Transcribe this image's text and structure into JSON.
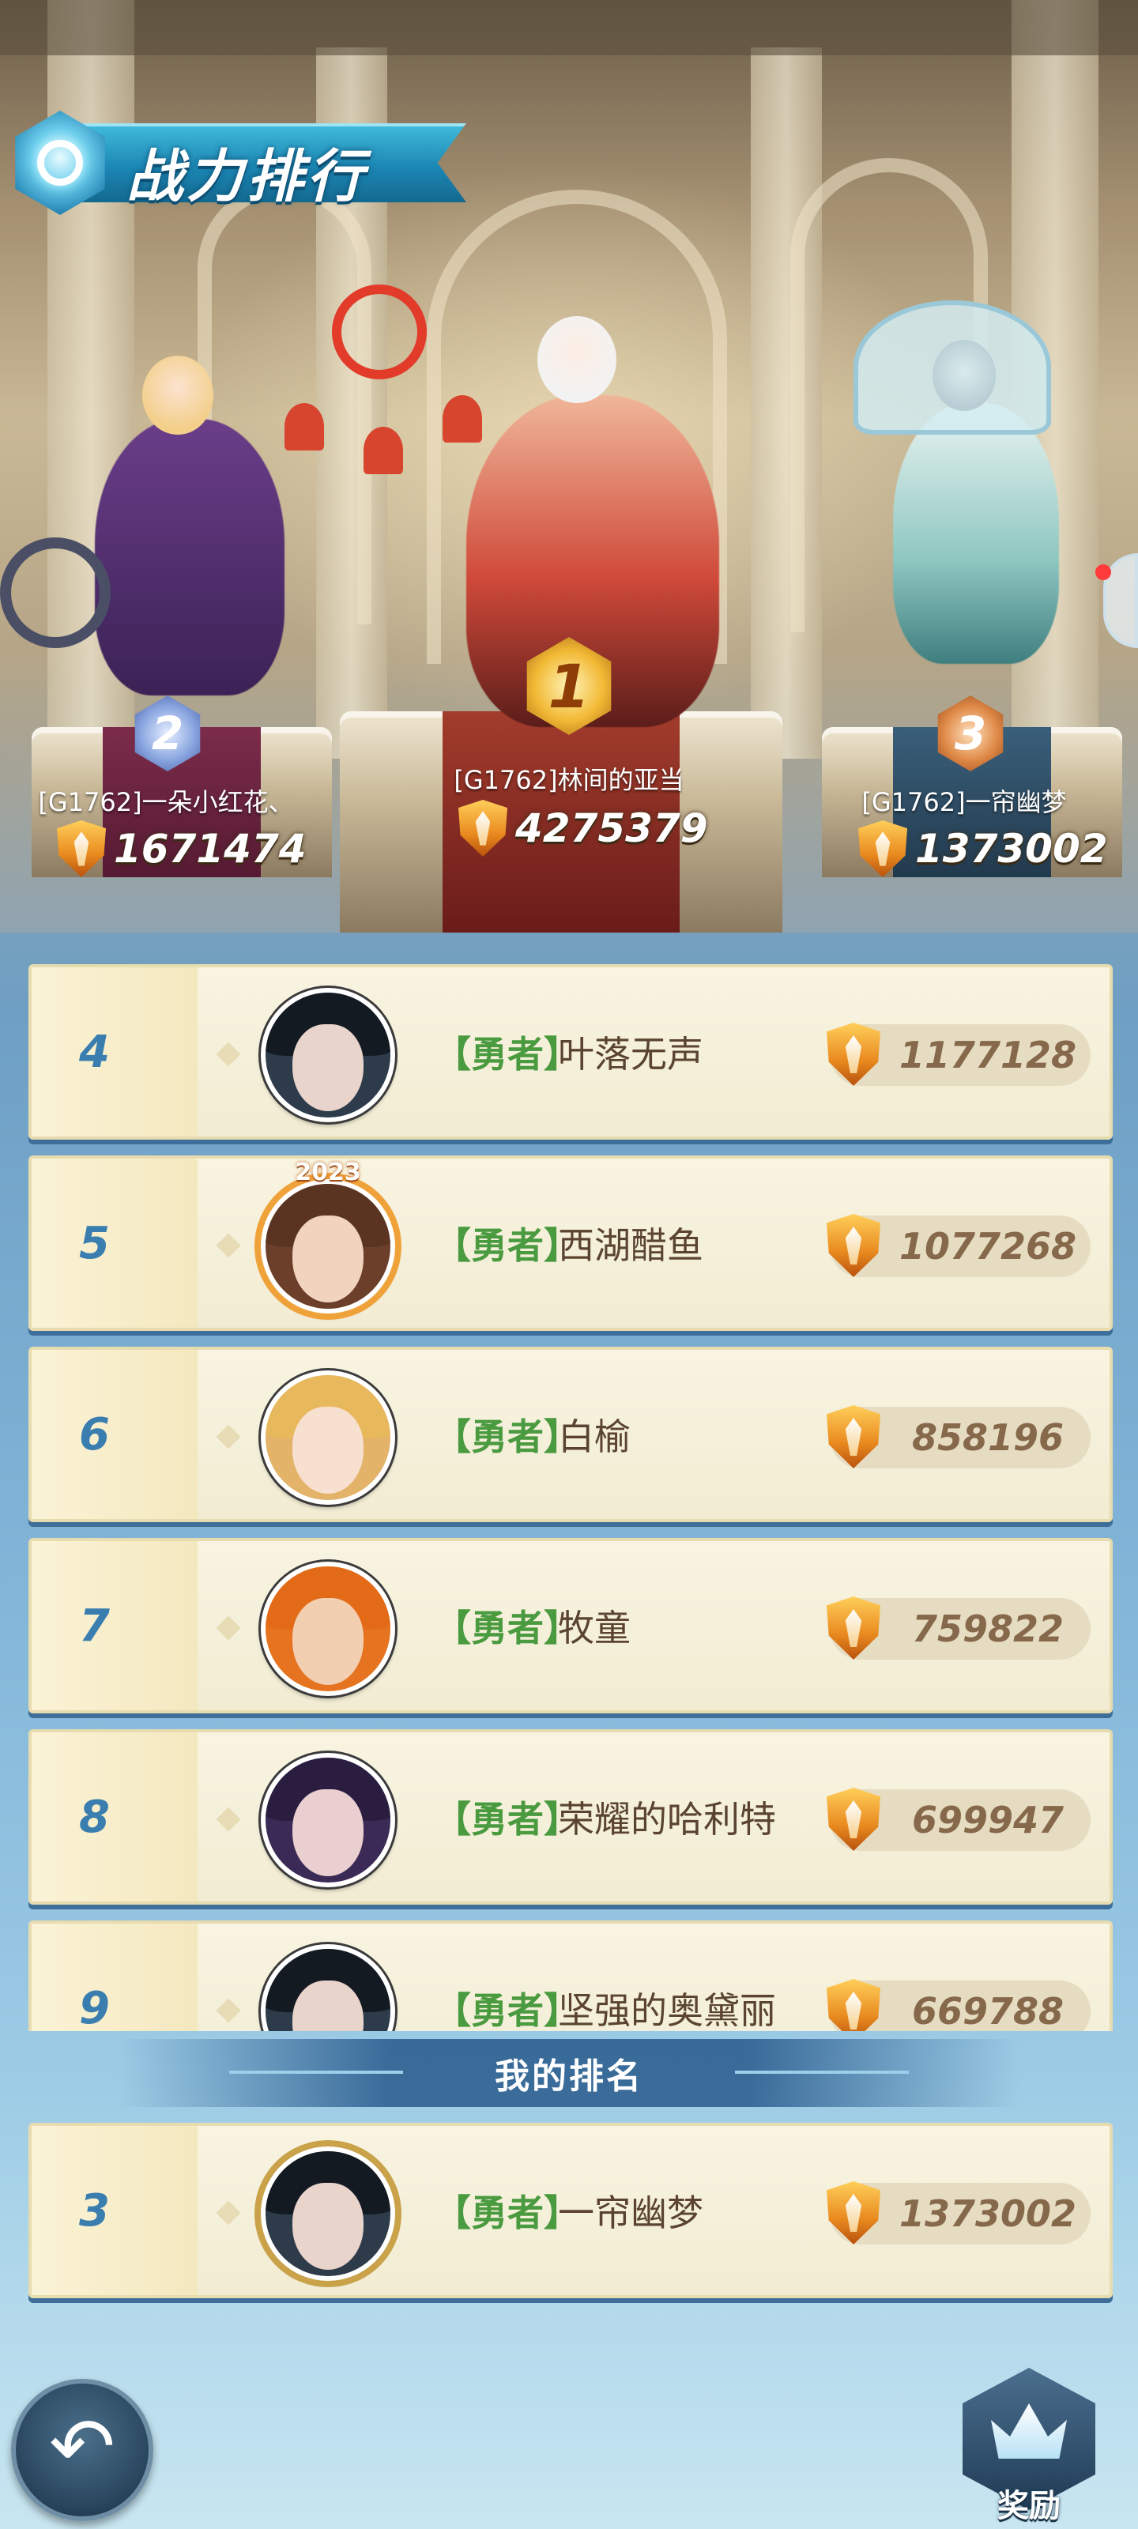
{
  "header": {
    "title": "战力排行"
  },
  "podium": [
    {
      "rank": "2",
      "name": "[G1762]一朵小红花、",
      "power": "1671474"
    },
    {
      "rank": "1",
      "name": "[G1762]林间的亚当",
      "power": "4275379"
    },
    {
      "rank": "3",
      "name": "[G1762]一帘幽梦",
      "power": "1373002"
    }
  ],
  "list": [
    {
      "rank": "4",
      "tag": "【勇者】",
      "name": "叶落无声",
      "power": "1177128",
      "avatar_color": "#2d3b4a"
    },
    {
      "rank": "5",
      "tag": "【勇者】",
      "name": "西湖醋鱼",
      "power": "1077268",
      "avatar_color": "#6b3f2a",
      "frame_text": "2023"
    },
    {
      "rank": "6",
      "tag": "【勇者】",
      "name": "白榆",
      "power": "858196",
      "avatar_color": "#e3b36a"
    },
    {
      "rank": "7",
      "tag": "【勇者】",
      "name": "牧童",
      "power": "759822",
      "avatar_color": "#e5731f"
    },
    {
      "rank": "8",
      "tag": "【勇者】",
      "name": "荣耀的哈利特",
      "power": "699947",
      "avatar_color": "#3a2a55"
    },
    {
      "rank": "9",
      "tag": "【勇者】",
      "name": "坚强的奥黛丽",
      "power": "669788",
      "avatar_color": "#2d3b4a"
    }
  ],
  "my_rank": {
    "section_label": "我的排名",
    "rank": "3",
    "tag": "【勇者】",
    "name": "一帘幽梦",
    "power": "1373002"
  },
  "buttons": {
    "back_icon": "back-arrow-icon",
    "reward_label": "奖励"
  },
  "colors": {
    "rank_text": "#3a7eb0",
    "tag_green": "#4a9a3f",
    "name_brown": "#5a4430",
    "power_brown": "#86684b"
  }
}
